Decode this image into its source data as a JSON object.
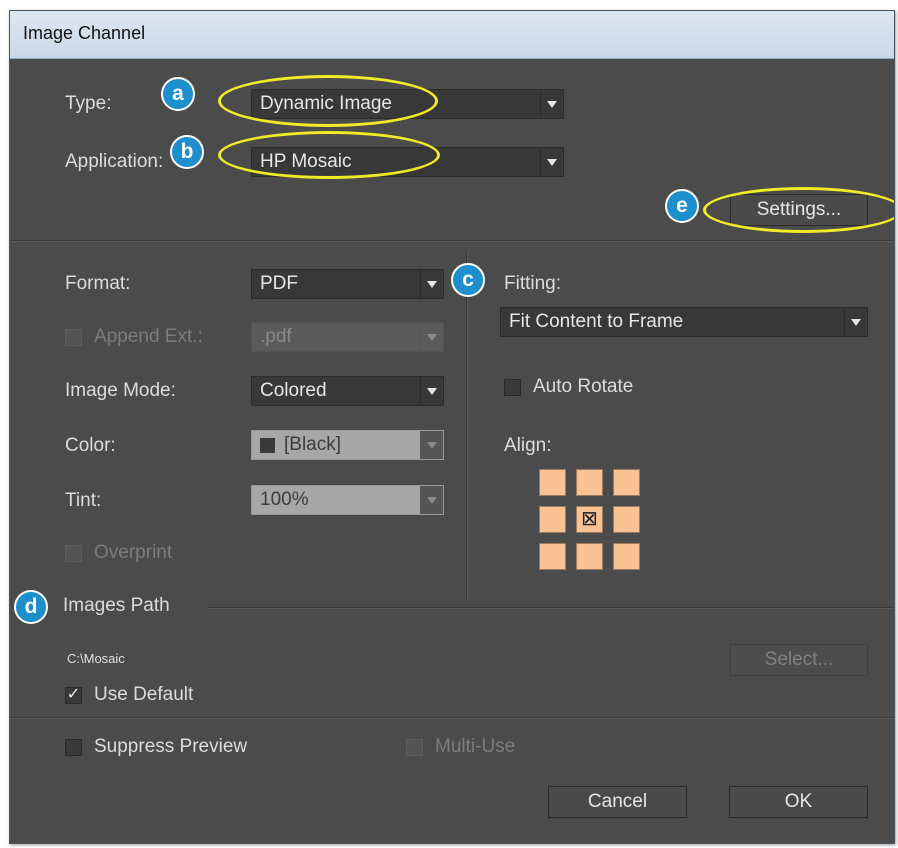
{
  "window": {
    "title": "Image Channel"
  },
  "type_row": {
    "label": "Type:",
    "value": "Dynamic Image"
  },
  "application_row": {
    "label": "Application:",
    "value": "HP Mosaic"
  },
  "settings_button": {
    "label": "Settings..."
  },
  "format_row": {
    "label": "Format:",
    "value": "PDF"
  },
  "append_ext": {
    "label": "Append Ext.:",
    "value": ".pdf",
    "checked": false,
    "enabled": false
  },
  "image_mode_row": {
    "label": "Image Mode:",
    "value": "Colored"
  },
  "color_row": {
    "label": "Color:",
    "value": "[Black]",
    "enabled": false
  },
  "tint_row": {
    "label": "Tint:",
    "value": "100%",
    "enabled": false
  },
  "overprint": {
    "label": "Overprint",
    "checked": false,
    "enabled": false
  },
  "fitting": {
    "label": "Fitting:",
    "value": "Fit Content to Frame"
  },
  "auto_rotate": {
    "label": "Auto Rotate",
    "checked": false
  },
  "align": {
    "label": "Align:",
    "selected": "center",
    "selected_glyph": "⊠"
  },
  "images_path": {
    "heading": "Images Path",
    "path": "C:\\Mosaic",
    "select_label": "Select...",
    "use_default_label": "Use Default",
    "use_default_checked": true,
    "check_glyph": "✓"
  },
  "suppress_preview": {
    "label": "Suppress Preview",
    "checked": false
  },
  "multi_use": {
    "label": "Multi-Use",
    "checked": false,
    "enabled": false
  },
  "footer": {
    "cancel_label": "Cancel",
    "ok_label": "OK"
  },
  "callouts": {
    "a": "a",
    "b": "b",
    "c": "c",
    "d": "d",
    "e": "e"
  },
  "colors": {
    "dialog_bg": "#4b4b4b",
    "callout_blue": "#1d8fcd",
    "highlight_yellow": "#f1ea26",
    "align_cell": "#f8c294"
  },
  "icons": {
    "dropdown_arrow": "chevron-down-icon",
    "align_center": "x-box-icon",
    "checkmark": "check-icon"
  }
}
